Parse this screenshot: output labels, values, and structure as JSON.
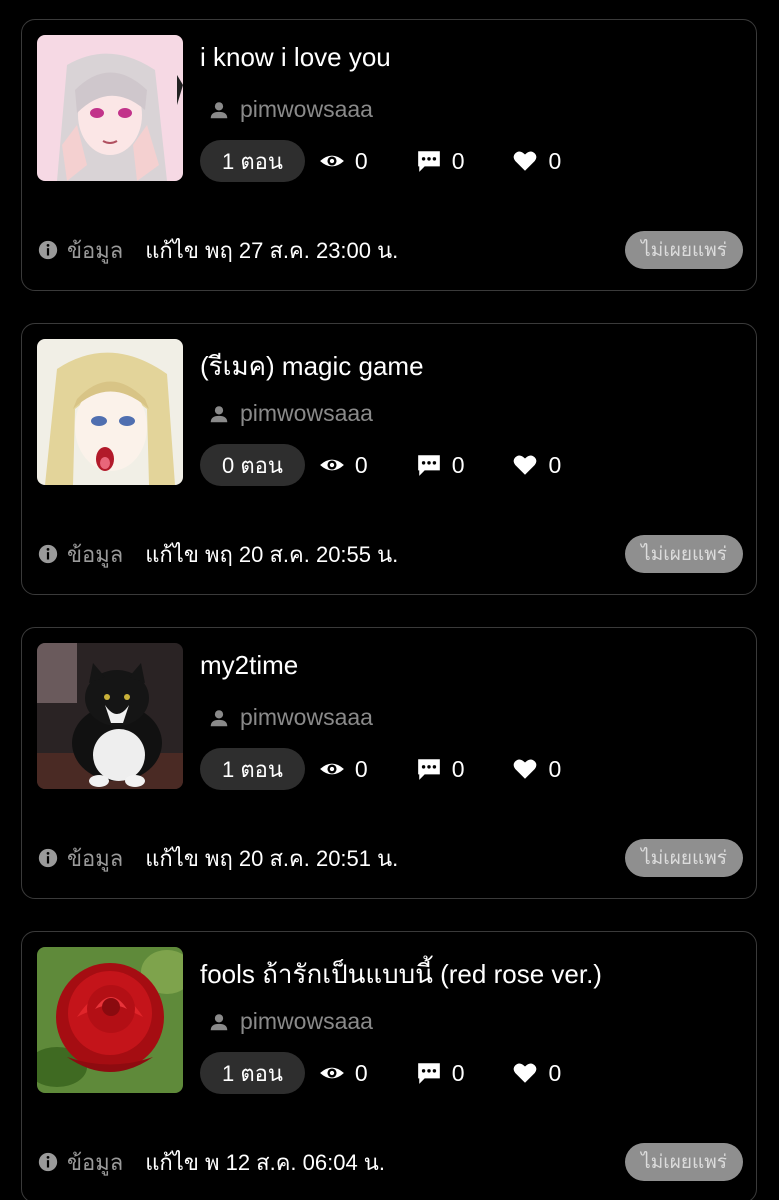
{
  "stories": [
    {
      "title": "i know i love you",
      "author": "pimwowsaaa",
      "episodes": "1 ตอน",
      "views": "0",
      "comments": "0",
      "likes": "0",
      "info_label": "ข้อมูล",
      "edited": "แก้ไข พฤ 27 ส.ค. 23:00 น.",
      "status": "ไม่เผยแพร่",
      "cover_icon": "anime-girl-silver-hair-cover"
    },
    {
      "title": "(รีเมค) magic game",
      "author": "pimwowsaaa",
      "episodes": "0 ตอน",
      "views": "0",
      "comments": "0",
      "likes": "0",
      "info_label": "ข้อมูล",
      "edited": "แก้ไข พฤ 20 ส.ค. 20:55 น.",
      "status": "ไม่เผยแพร่",
      "cover_icon": "anime-blonde-character-cover"
    },
    {
      "title": "my2time",
      "author": "pimwowsaaa",
      "episodes": "1 ตอน",
      "views": "0",
      "comments": "0",
      "likes": "0",
      "info_label": "ข้อมูล",
      "edited": "แก้ไข พฤ 20 ส.ค. 20:51 น.",
      "status": "ไม่เผยแพร่",
      "cover_icon": "black-white-cat-cover"
    },
    {
      "title": "fools ถ้ารักเป็นแบบนี้ (red rose ver.)",
      "author": "pimwowsaaa",
      "episodes": "1 ตอน",
      "views": "0",
      "comments": "0",
      "likes": "0",
      "info_label": "ข้อมูล",
      "edited": "แก้ไข พ 12 ส.ค. 06:04 น.",
      "status": "ไม่เผยแพร่",
      "cover_icon": "red-rose-cover"
    }
  ],
  "colors": {
    "background": "#000000",
    "card_border": "#3a3a3a",
    "muted_text": "#8a8a8a",
    "pill_bg": "#2e2e2e",
    "status_bg": "#8f8f8f"
  }
}
